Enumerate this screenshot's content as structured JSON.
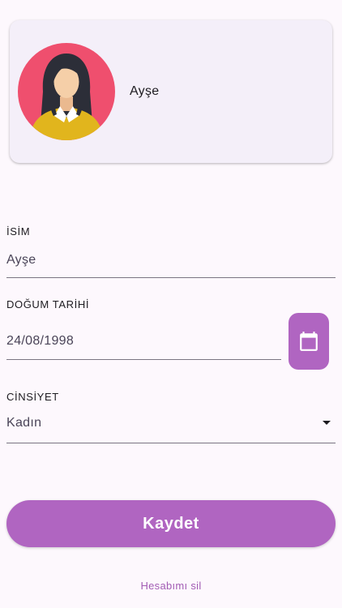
{
  "profile": {
    "name": "Ayşe",
    "avatar_icon": "woman-avatar-icon"
  },
  "form": {
    "name_field": {
      "label": "İSİM",
      "value": "Ayşe"
    },
    "birthdate_field": {
      "label": "DOĞUM TARİHİ",
      "value": "24/08/1998",
      "picker_icon": "calendar-icon"
    },
    "gender_field": {
      "label": "CİNSİYET",
      "selected": "Kadın",
      "dropdown_icon": "arrow-drop-down-icon"
    }
  },
  "actions": {
    "save_label": "Kaydet",
    "delete_account_label": "Hesabımı sil"
  },
  "colors": {
    "accent": "#b065c1",
    "background": "#fdf8fd",
    "card": "#f4eff9",
    "avatar_background": "#ef4f6e"
  }
}
